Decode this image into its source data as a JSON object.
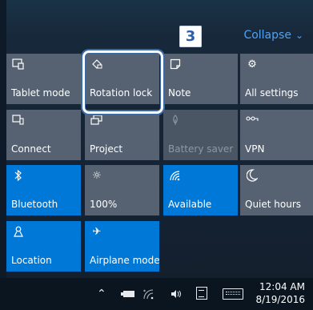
{
  "header": {
    "collapse_label": "Collapse",
    "step_number": "3"
  },
  "tiles": [
    {
      "label": "Tablet mode",
      "icon": "tablet-mode-icon"
    },
    {
      "label": "Rotation lock",
      "icon": "rotation-lock-icon"
    },
    {
      "label": "Note",
      "icon": "note-icon"
    },
    {
      "label": "All settings",
      "icon": "gear-icon"
    },
    {
      "label": "Connect",
      "icon": "connect-icon"
    },
    {
      "label": "Project",
      "icon": "project-icon"
    },
    {
      "label": "Battery saver",
      "icon": "battery-saver-icon"
    },
    {
      "label": "VPN",
      "icon": "vpn-icon"
    },
    {
      "label": "Bluetooth",
      "icon": "bluetooth-icon"
    },
    {
      "label": "100%",
      "icon": "brightness-icon"
    },
    {
      "label": "Available",
      "icon": "wifi-icon"
    },
    {
      "label": "Quiet hours",
      "icon": "moon-icon"
    },
    {
      "label": "Location",
      "icon": "location-icon"
    },
    {
      "label": "Airplane mode",
      "icon": "airplane-icon"
    }
  ],
  "taskbar": {
    "time": "12:04 AM",
    "date": "8/19/2016"
  },
  "colors": {
    "tile_default": "#566271",
    "tile_active": "#0078d7",
    "accent_link": "#4ea3f5"
  }
}
